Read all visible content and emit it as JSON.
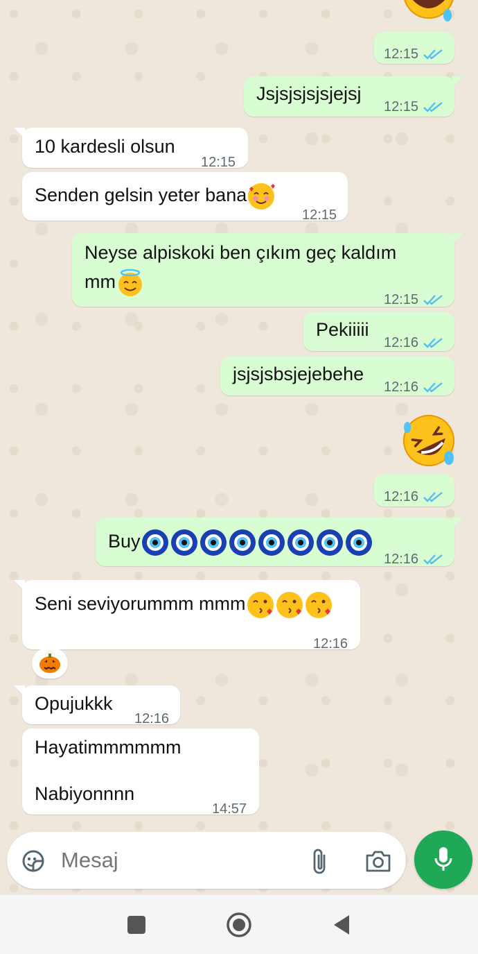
{
  "messages": [
    {
      "id": "m1",
      "dir": "out",
      "time": "12:15"
    },
    {
      "id": "m2",
      "dir": "out",
      "text": "Jsjsjsjsjsjejsj",
      "time": "12:15"
    },
    {
      "id": "m3",
      "dir": "in",
      "text": "10 kardesli olsun",
      "time": "12:15"
    },
    {
      "id": "m4",
      "dir": "in",
      "text": "Senden gelsin yeter bana",
      "time": "12:15"
    },
    {
      "id": "m5",
      "dir": "out",
      "line1": "Neyse alpiskoki ben çıkım geç kaldım",
      "line2": "mm",
      "time": "12:15"
    },
    {
      "id": "m6",
      "dir": "out",
      "text": "Pekiiiii",
      "time": "12:16"
    },
    {
      "id": "m7",
      "dir": "out",
      "text": "jsjsjsbsjejebehe",
      "time": "12:16"
    },
    {
      "id": "m8",
      "dir": "out",
      "time": "12:16"
    },
    {
      "id": "m9",
      "dir": "out",
      "text": "Buy",
      "time": "12:16"
    },
    {
      "id": "m10",
      "dir": "in",
      "text": "Seni seviyorummm mmm",
      "time": "12:16"
    },
    {
      "id": "m11",
      "dir": "in",
      "text": "Opujukkk",
      "time": "12:16"
    },
    {
      "id": "m12",
      "dir": "in",
      "line1": "Hayatimmmmmm",
      "line2": "Nabiyonnnn",
      "time": "14:57"
    }
  ],
  "icons": {
    "laugh": "rolling-on-floor-laughing-emoji",
    "smile_hearts": "smiling-face-with-hearts-emoji",
    "halo": "smiling-face-with-halo-emoji",
    "nazar": "nazar-amulet-emoji",
    "kiss": "face-blowing-kiss-emoji",
    "reaction": "jack-o-lantern-emoji"
  },
  "input": {
    "placeholder": "Mesaj"
  },
  "colors": {
    "outgoing": "#d9fdd3",
    "incoming": "#ffffff",
    "ticks": "#53bdeb",
    "mic": "#1fa855"
  }
}
